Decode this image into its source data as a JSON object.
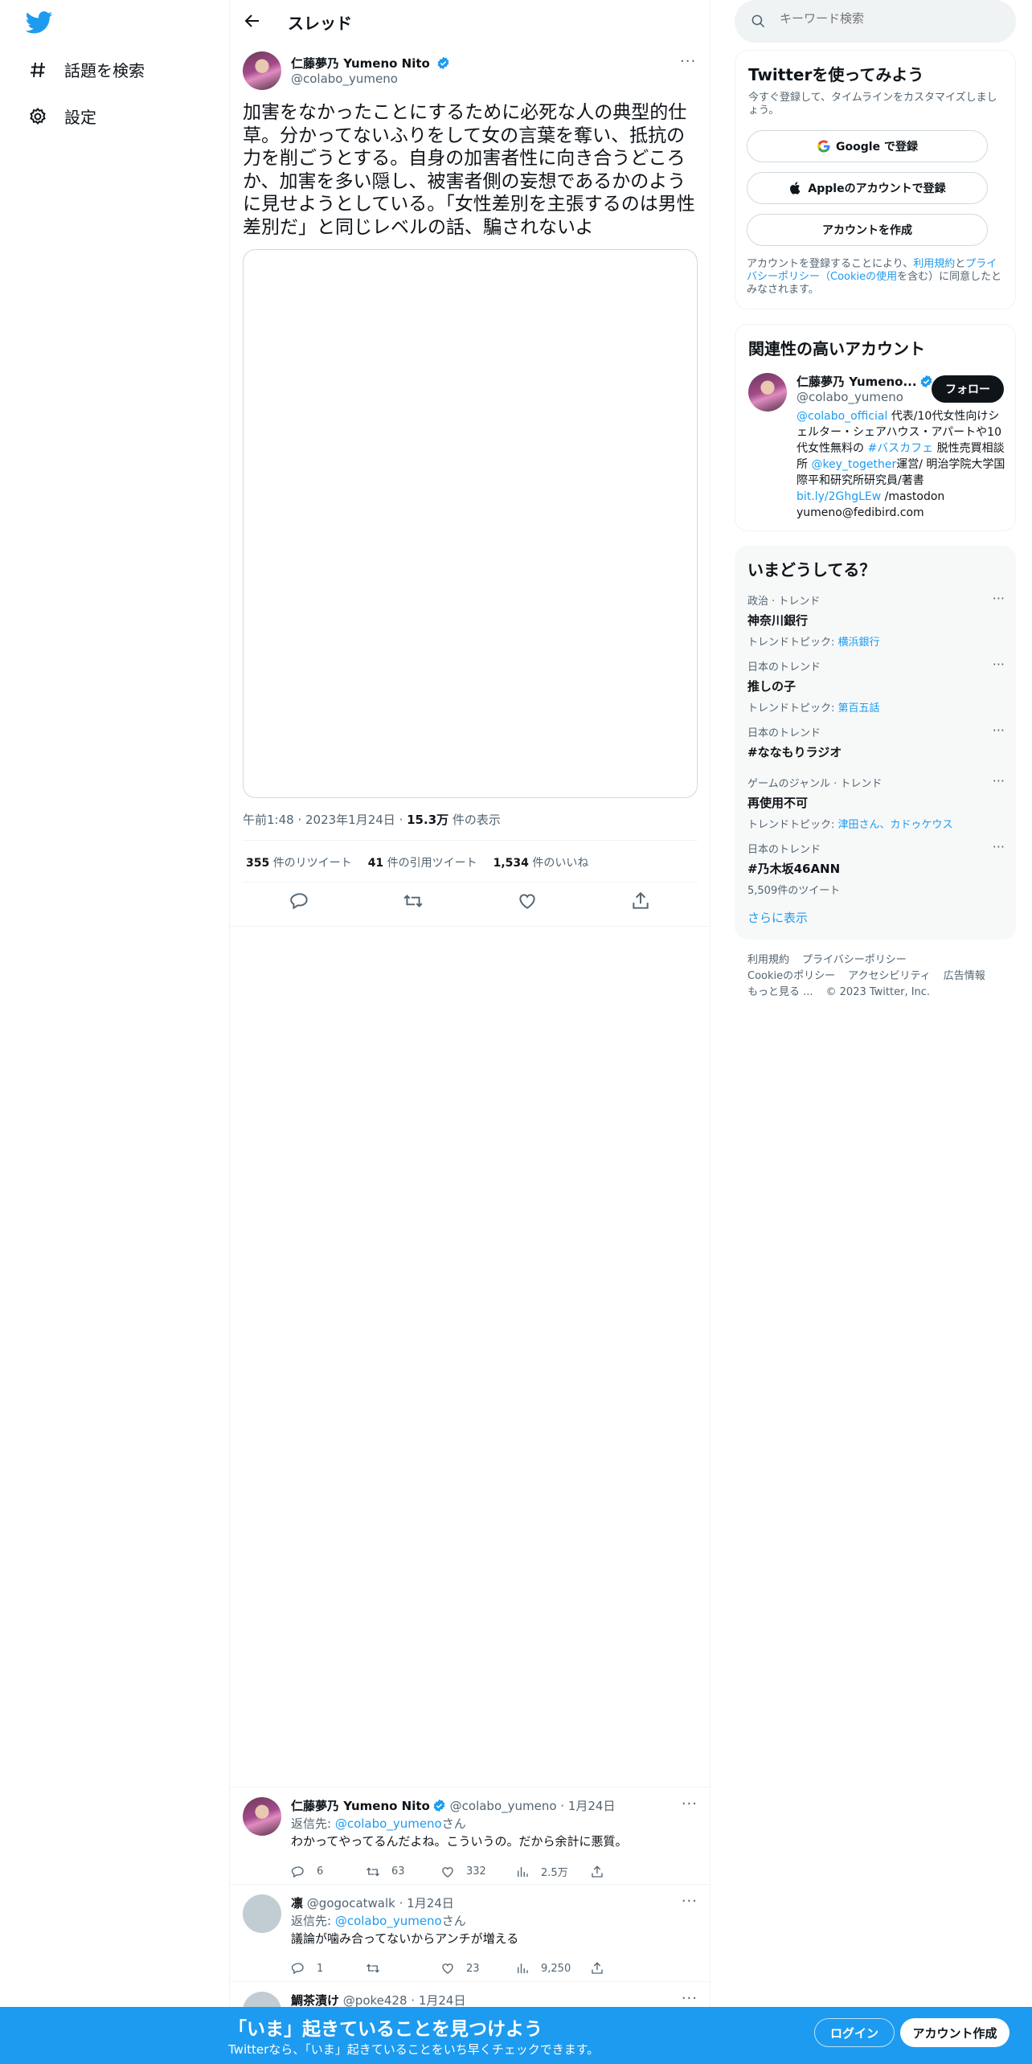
{
  "nav": {
    "items": [
      {
        "label": "話題を検索",
        "icon": "hashtag-icon"
      },
      {
        "label": "設定",
        "icon": "gear-icon"
      }
    ]
  },
  "header": {
    "title": "スレッド"
  },
  "tweet": {
    "name": "仁藤夢乃 Yumeno Nito",
    "handle": "@colabo_yumeno",
    "text": "加害をなかったことにするために必死な人の典型的仕草。分かってないふりをして女の言葉を奪い、抵抗の力を削ごうとする。自身の加害者性に向き合うどころか、加害を多い隠し、被害者側の妄想であるかのように見せようとしている。「女性差別を主張するのは男性差別だ」と同じレベルの話、騙されないよ",
    "time": "午前1:48",
    "date": "2023年1月24日",
    "views_count": "15.3万",
    "views_label": "件の表示",
    "retweets_count": "355",
    "retweets_label": "件のリツイート",
    "quotes_count": "41",
    "quotes_label": "件の引用ツイート",
    "likes_count": "1,534",
    "likes_label": "件のいいね"
  },
  "replies": [
    {
      "name": "仁藤夢乃 Yumeno Nito",
      "handle": "@colabo_yumeno",
      "date": "1月24日",
      "reply_prefix": "返信先:",
      "reply_to": "@colabo_yumeno",
      "reply_suffix": "さん",
      "text": "わかってやってるんだよね。こういうの。だから余計に悪質。",
      "replies": "6",
      "retweets": "63",
      "likes": "332",
      "views": "2.5万"
    },
    {
      "name": "凛",
      "handle": "@gogocatwalk",
      "date": "1月24日",
      "reply_prefix": "返信先:",
      "reply_to": "@colabo_yumeno",
      "reply_suffix": "さん",
      "text": "議論が噛み合ってないからアンチが増える",
      "replies": "1",
      "retweets": "",
      "likes": "23",
      "views": "9,250"
    },
    {
      "name": "鯛茶漬け",
      "handle": "@poke428",
      "date": "1月24日"
    }
  ],
  "search": {
    "placeholder": "キーワード検索"
  },
  "signup_card": {
    "title": "Twitterを使ってみよう",
    "subtitle": "今すぐ登録して、タイムラインをカスタマイズしましょう。",
    "google": "Google で登録",
    "apple": "Appleのアカウントで登録",
    "create": "アカウントを作成",
    "terms_pre": "アカウントを登録することにより、",
    "terms_link1": "利用規約",
    "terms_mid": "と",
    "terms_link2": "プライバシーポリシー（Cookieの使用",
    "terms_post": "を含む）に同意したとみなされます。"
  },
  "related": {
    "title": "関連性の高いアカウント",
    "name": "仁藤夢乃 Yumeno...",
    "handle": "@colabo_yumeno",
    "follow": "フォロー",
    "bio": [
      {
        "t": "@colabo_official",
        "link": true
      },
      {
        "t": " 代表/10代女性向けシェルター・シェアハウス・アパートや10代女性無料の ",
        "link": false
      },
      {
        "t": "#バスカフェ",
        "link": true
      },
      {
        "t": " 脱性売買相談所 ",
        "link": false
      },
      {
        "t": "@key_together",
        "link": true
      },
      {
        "t": "運営/ 明治学院大学国際平和研究所研究員/著書",
        "link": false
      },
      {
        "t": "bit.ly/2GhgLEw",
        "link": true
      },
      {
        "t": " /mastodon yumeno@fedibird.com",
        "link": false
      }
    ]
  },
  "trends": {
    "title": "いまどうしてる？",
    "items": [
      {
        "category": "政治 · トレンド",
        "name": "神奈川銀行",
        "topic_label": "トレンドトピック: ",
        "topic": "横浜銀行",
        "count": ""
      },
      {
        "category": "日本のトレンド",
        "name": "推しの子",
        "topic_label": "トレンドトピック: ",
        "topic": "第百五話",
        "count": ""
      },
      {
        "category": "日本のトレンド",
        "name": "#ななもりラジオ",
        "topic_label": "",
        "topic": "",
        "count": ""
      },
      {
        "category": "ゲームのジャンル · トレンド",
        "name": "再使用不可",
        "topic_label": "トレンドトピック: ",
        "topic": "津田さん、カドゥケウス",
        "count": ""
      },
      {
        "category": "日本のトレンド",
        "name": "#乃木坂46ANN",
        "topic_label": "",
        "topic": "",
        "count": "5,509件のツイート"
      }
    ],
    "show_more": "さらに表示"
  },
  "footer": {
    "links": [
      "利用規約",
      "プライバシーポリシー",
      "Cookieのポリシー",
      "アクセシビリティ",
      "広告情報",
      "もっと見る ...",
      "© 2023 Twitter, Inc."
    ]
  },
  "banner": {
    "headline": "「いま」起きていることを見つけよう",
    "sub": "Twitterなら、「いま」起きていることをいち早くチェックできます。",
    "login": "ログイン",
    "signup": "アカウント作成"
  },
  "colors": {
    "accent": "#1d9bf0",
    "text": "#0f1419",
    "muted": "#536471"
  }
}
